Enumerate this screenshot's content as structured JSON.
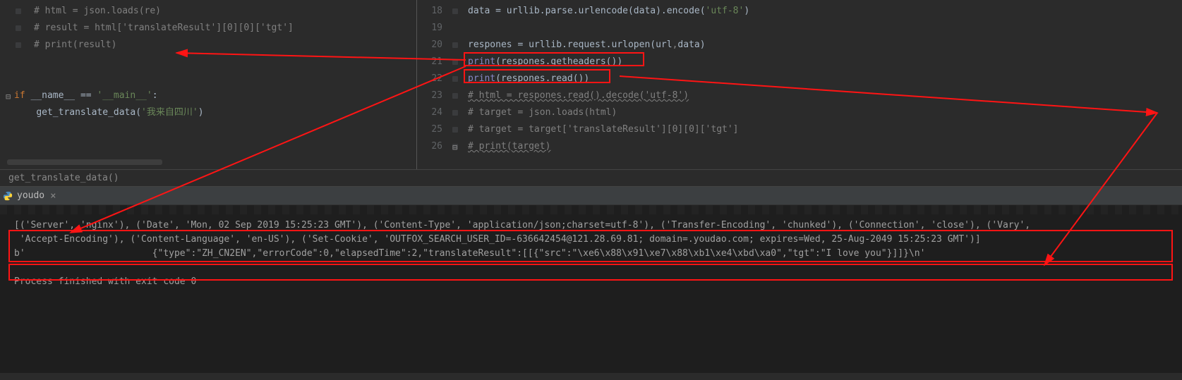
{
  "left_code": {
    "l1": "# html = json.loads(re)",
    "l2": "# result = html['translateResult'][0][0]['tgt']",
    "l3": "# print(result)",
    "kw_if": "if",
    "name_var": " __name__ ",
    "eq": "== ",
    "main_str": "'__main__'",
    "colon": ":",
    "indent": "    ",
    "call_func": "get_translate_data",
    "oparen": "(",
    "arg_str": "'我来自四川'",
    "cparen": ")"
  },
  "right_code": {
    "lines": {
      "18": {
        "pre": "data = urllib.parse.urlencode(data).encode(",
        "str": "'utf-8'",
        "post": ")"
      },
      "19": {
        "blank": ""
      },
      "20": {
        "pre": "respones = urllib.request.urlopen(url",
        "mid": ",",
        "post": "data)"
      },
      "21": {
        "print": "print",
        "op": "(",
        "body": "respones.getheaders()",
        "cp": ")"
      },
      "22": {
        "print": "print",
        "op": "(",
        "body": "respones.read()",
        "cp": ")"
      },
      "23": {
        "comment": "# html = respones.read().decode('utf-8')"
      },
      "24": {
        "comment": "# target = json.loads(html)"
      },
      "25": {
        "comment": "# target = target['translateResult'][0][0]['tgt']"
      },
      "26": {
        "comment": "# print(target)"
      }
    },
    "line_nums": [
      "18",
      "19",
      "20",
      "21",
      "22",
      "23",
      "24",
      "25",
      "26"
    ]
  },
  "breadcrumb": "get_translate_data()",
  "tab": {
    "label": "youdo"
  },
  "console": {
    "out1": "[('Server', 'nginx'), ('Date', 'Mon, 02 Sep 2019 15:25:23 GMT'), ('Content-Type', 'application/json;charset=utf-8'), ('Transfer-Encoding', 'chunked'), ('Connection', 'close'), ('Vary',",
    "out2": " 'Accept-Encoding'), ('Content-Language', 'en-US'), ('Set-Cookie', 'OUTFOX_SEARCH_USER_ID=-636642454@121.28.69.81; domain=.youdao.com; expires=Wed, 25-Aug-2049 15:25:23 GMT')]",
    "out3": "b'                       {\"type\":\"ZH_CN2EN\",\"errorCode\":0,\"elapsedTime\":2,\"translateResult\":[[{\"src\":\"\\xe6\\x88\\x91\\xe7\\x88\\xb1\\xe4\\xbd\\xa0\",\"tgt\":\"I love you\"}]]}\\n'",
    "exit": "Process finished with exit code 0"
  }
}
